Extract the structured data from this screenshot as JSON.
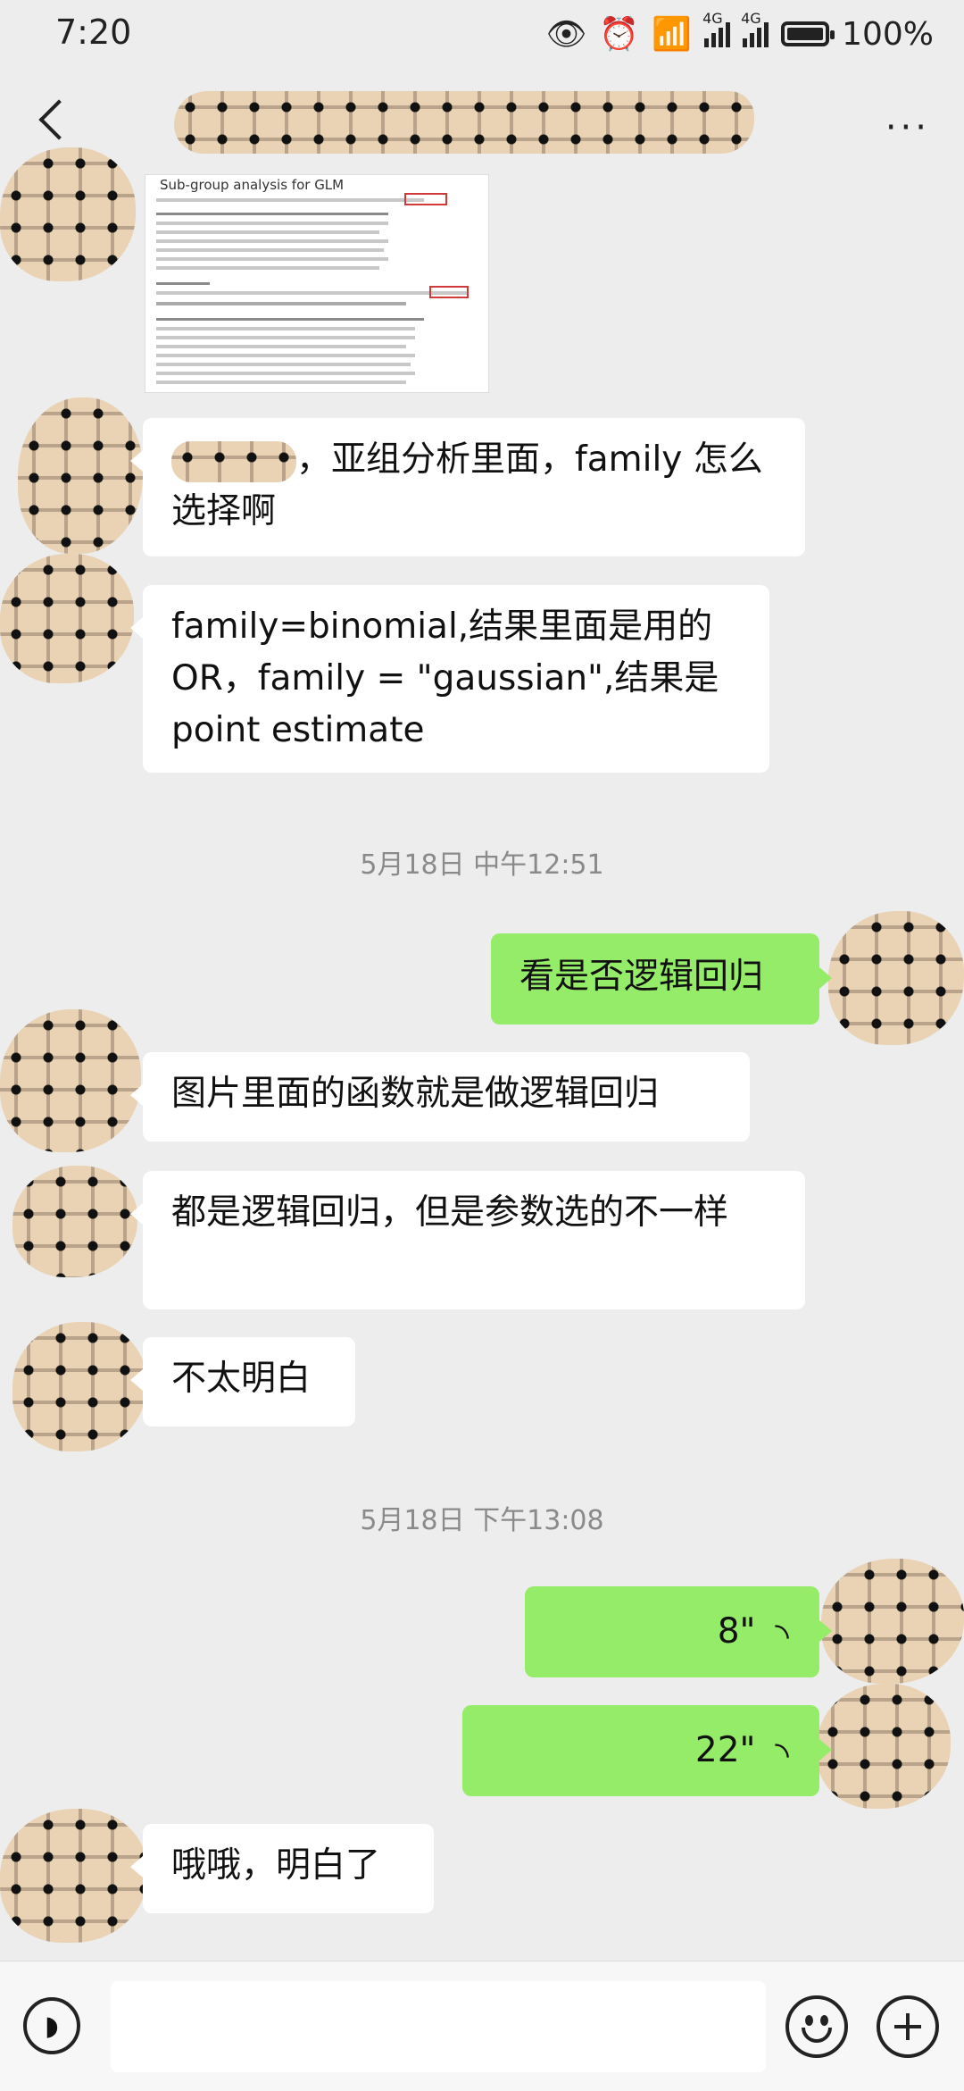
{
  "status_bar": {
    "time": "7:20",
    "network_1": "4G",
    "network_2": "4G",
    "battery": "100%"
  },
  "header": {
    "back_icon": "chevron-left-icon",
    "more_label": "···"
  },
  "messages": [
    {
      "side": "left",
      "type": "image",
      "caption": "Sub-group analysis for GLM"
    },
    {
      "side": "left",
      "type": "text",
      "text": "，亚组分析里面，family 怎么选择啊"
    },
    {
      "side": "left",
      "type": "text",
      "text": "family=binomial,结果里面是用的OR，family = \"gaussian\",结果是point estimate"
    },
    {
      "side": "center",
      "type": "timestamp",
      "text": "5月18日 中午12:51"
    },
    {
      "side": "right",
      "type": "text",
      "text": "看是否逻辑回归"
    },
    {
      "side": "left",
      "type": "text",
      "text": "图片里面的函数就是做逻辑回归"
    },
    {
      "side": "left",
      "type": "text",
      "text": "都是逻辑回归，但是参数选的不一样"
    },
    {
      "side": "left",
      "type": "text",
      "text": "不太明白"
    },
    {
      "side": "center",
      "type": "timestamp",
      "text": "5月18日 下午13:08"
    },
    {
      "side": "right",
      "type": "voice",
      "duration": "8\""
    },
    {
      "side": "right",
      "type": "voice",
      "duration": "22\""
    },
    {
      "side": "left",
      "type": "text",
      "text": "哦哦，明白了"
    }
  ],
  "input_bar": {
    "voice_icon": "voice-input-icon",
    "input_value": "",
    "emoji_icon": "emoji-icon",
    "plus_icon": "plus-icon"
  },
  "colors": {
    "background": "#ededed",
    "own_bubble": "#95ec69",
    "other_bubble": "#ffffff"
  }
}
